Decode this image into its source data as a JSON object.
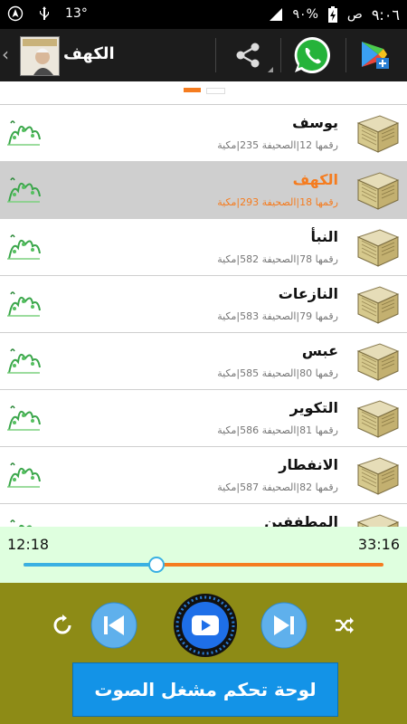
{
  "status_bar": {
    "temperature": "13°",
    "battery": "٩٠%",
    "time": "٩:٠٦",
    "am_pm": "ص"
  },
  "action_bar": {
    "title": "الكهف",
    "icons": [
      "back-chevron-icon",
      "app-logo",
      "share-icon",
      "whatsapp-icon",
      "store-plus-icon"
    ]
  },
  "pager": {
    "active_color": "#f57c1f",
    "inactive_color": "#ffffff"
  },
  "surahs": [
    {
      "name": "يوسف",
      "meta": "رقمها 12|الصحيفة 235|مكية",
      "selected": false
    },
    {
      "name": "الكهف",
      "meta": "رقمها 18|الصحيفة 293|مكية",
      "selected": true
    },
    {
      "name": "النبأ",
      "meta": "رقمها 78|الصحيفة 582|مكية",
      "selected": false
    },
    {
      "name": "النازعات",
      "meta": "رقمها 79|الصحيفة 583|مكية",
      "selected": false
    },
    {
      "name": "عبس",
      "meta": "رقمها 80|الصحيفة 585|مكية",
      "selected": false
    },
    {
      "name": "التكوير",
      "meta": "رقمها 81|الصحيفة 586|مكية",
      "selected": false
    },
    {
      "name": "الانفطار",
      "meta": "رقمها 82|الصحيفة 587|مكية",
      "selected": false
    },
    {
      "name": "المطففين",
      "meta": "",
      "selected": false
    }
  ],
  "player": {
    "elapsed": "12:18",
    "duration": "33:16",
    "progress": 0.37,
    "panel_label": "لوحة تحكم مشغل الصوت",
    "colors": {
      "accent": "#f57c1f",
      "seek_fill": "#3ab0e2",
      "controls_bg": "#8d8b16",
      "times_bg": "#dfffdf",
      "button_bg": "#1393e7"
    }
  }
}
